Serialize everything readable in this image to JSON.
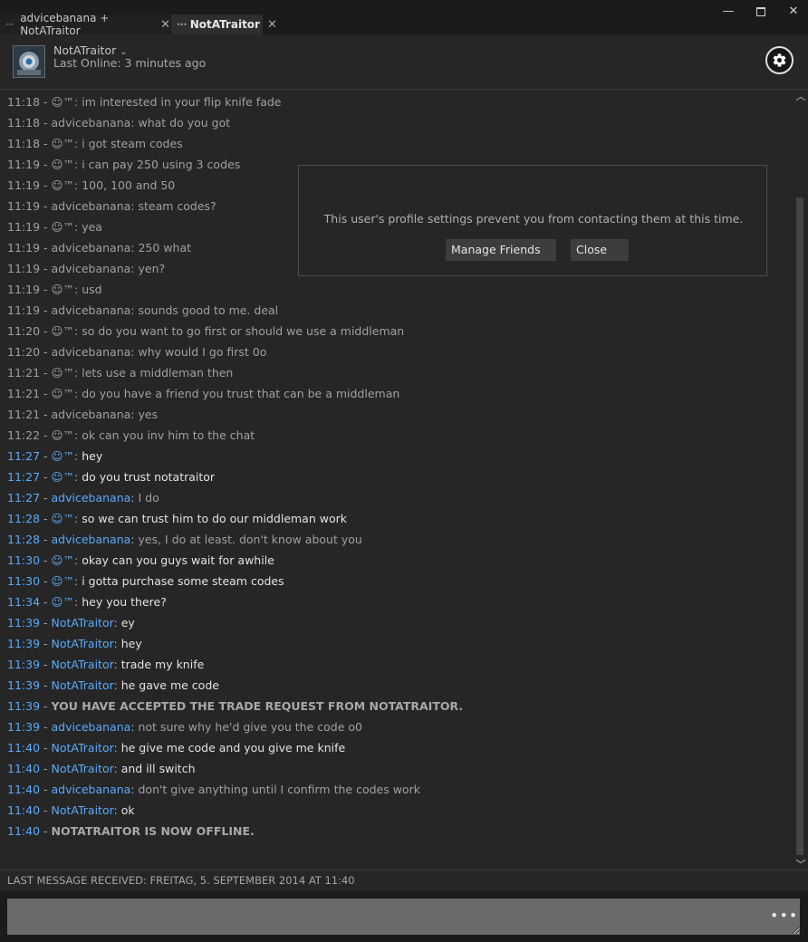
{
  "tabs": [
    {
      "label": "advicebanana + NotATraitor",
      "close": "✕"
    },
    {
      "label": "NotATraitor",
      "close": "✕"
    }
  ],
  "window": {
    "minimize": "—",
    "close": "✕"
  },
  "header": {
    "name": "NotATraitor",
    "status": "Last Online: 3 minutes ago"
  },
  "messages": [
    {
      "time": "11:18",
      "sender": "☺™",
      "text": "im interested in your flip knife fade",
      "style": "old"
    },
    {
      "time": "11:18",
      "sender": "advicebanana",
      "text": "what do you got",
      "style": "old"
    },
    {
      "time": "11:18",
      "sender": "☺™",
      "text": "i got steam codes",
      "style": "old"
    },
    {
      "time": "11:19",
      "sender": "☺™",
      "text": "i can pay 250 using 3 codes",
      "style": "old"
    },
    {
      "time": "11:19",
      "sender": "☺™",
      "text": "100, 100 and 50",
      "style": "old"
    },
    {
      "time": "11:19",
      "sender": "advicebanana",
      "text": "steam codes?",
      "style": "old"
    },
    {
      "time": "11:19",
      "sender": "☺™",
      "text": "yea",
      "style": "old"
    },
    {
      "time": "11:19",
      "sender": "advicebanana",
      "text": "250 what",
      "style": "old"
    },
    {
      "time": "11:19",
      "sender": "advicebanana",
      "text": "yen?",
      "style": "old"
    },
    {
      "time": "11:19",
      "sender": "☺™",
      "text": "usd",
      "style": "old"
    },
    {
      "time": "11:19",
      "sender": "advicebanana",
      "text": "sounds good to me. deal",
      "style": "old"
    },
    {
      "time": "11:20",
      "sender": "☺™",
      "text": "so do you want to go first or should we use a middleman",
      "style": "old"
    },
    {
      "time": "11:20",
      "sender": "advicebanana",
      "text": "why would I go first 0o",
      "style": "old"
    },
    {
      "time": "11:21",
      "sender": "☺™",
      "text": "lets use a middleman then",
      "style": "old"
    },
    {
      "time": "11:21",
      "sender": "☺™",
      "text": "do you have a friend you trust that can be a middleman",
      "style": "old"
    },
    {
      "time": "11:21",
      "sender": "advicebanana",
      "text": "yes",
      "style": "old"
    },
    {
      "time": "11:22",
      "sender": "☺™",
      "text": "ok can you inv him to the chat",
      "style": "old"
    },
    {
      "time": "11:27",
      "sender": "☺™",
      "text": "hey",
      "style": "new"
    },
    {
      "time": "11:27",
      "sender": "☺™",
      "text": "do you trust notatraitor",
      "style": "new"
    },
    {
      "time": "11:27",
      "sender": "advicebanana",
      "text": "I do",
      "style": "self"
    },
    {
      "time": "11:28",
      "sender": "☺™",
      "text": "so we can trust him to do our middleman work",
      "style": "new"
    },
    {
      "time": "11:28",
      "sender": "advicebanana",
      "text": "yes, I do at least. don't know about you",
      "style": "self"
    },
    {
      "time": "11:30",
      "sender": "☺™",
      "text": "okay can you guys wait for awhile",
      "style": "new"
    },
    {
      "time": "11:30",
      "sender": "☺™",
      "text": "i gotta purchase some steam codes",
      "style": "new"
    },
    {
      "time": "11:34",
      "sender": "☺™",
      "text": "hey you there?",
      "style": "new"
    },
    {
      "time": "11:39",
      "sender": "NotATraitor",
      "text": "ey",
      "style": "new"
    },
    {
      "time": "11:39",
      "sender": "NotATraitor",
      "text": "hey",
      "style": "new"
    },
    {
      "time": "11:39",
      "sender": "NotATraitor",
      "text": "trade my knife",
      "style": "new"
    },
    {
      "time": "11:39",
      "sender": "NotATraitor",
      "text": "he gave me code",
      "style": "new"
    },
    {
      "time": "11:39",
      "sender": "",
      "text": "YOU HAVE ACCEPTED THE TRADE REQUEST FROM NOTATRAITOR.",
      "style": "system"
    },
    {
      "time": "11:39",
      "sender": "advicebanana",
      "text": "not sure why he'd give you the code o0",
      "style": "self"
    },
    {
      "time": "11:40",
      "sender": "NotATraitor",
      "text": "he give me code and you give me knife",
      "style": "new"
    },
    {
      "time": "11:40",
      "sender": "NotATraitor",
      "text": "and ill switch",
      "style": "new"
    },
    {
      "time": "11:40",
      "sender": "advicebanana",
      "text": "don't give anything until I confirm the codes work",
      "style": "self"
    },
    {
      "time": "11:40",
      "sender": "NotATraitor",
      "text": "ok",
      "style": "new"
    },
    {
      "time": "11:40",
      "sender": "",
      "text": "NOTATRAITOR IS NOW OFFLINE.",
      "style": "system"
    }
  ],
  "popup": {
    "message": "This user's profile settings prevent you from contacting them at this time.",
    "manage_button": "Manage Friends",
    "close_button": "Close"
  },
  "footer": {
    "last_received": "LAST MESSAGE RECEIVED: FREITAG, 5. SEPTEMBER 2014 AT 11:40",
    "input_value": "",
    "more_label": "•••"
  },
  "icons": {
    "tab_menu": "ellipsis-icon",
    "settings": "gear-icon",
    "dropdown": "chevron-down-icon"
  },
  "colors": {
    "accent_blue": "#5aaafa",
    "background": "#262626",
    "titlebar": "#1b1b1b"
  }
}
